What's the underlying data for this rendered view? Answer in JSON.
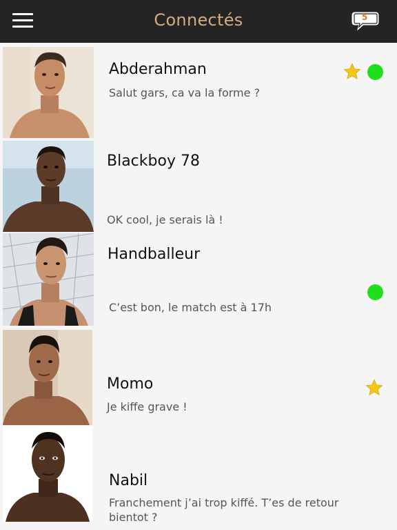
{
  "header": {
    "title": "Connectés",
    "menu_icon": "hamburger-menu-icon",
    "messages_icon": "chat-bubble-icon",
    "unread_count": "5",
    "unread_color": "#e0701a"
  },
  "colors": {
    "topbar": "#242424",
    "title": "#d8ac7c",
    "online": "#1ee01a",
    "star": "#f5c518"
  },
  "contacts": [
    {
      "name": "Abderahman",
      "last_message": "Salut gars, ca va la forme ?",
      "favorite": true,
      "online": true
    },
    {
      "name": "Blackboy 78",
      "last_message": "OK cool, je serais là !",
      "favorite": false,
      "online": false
    },
    {
      "name": "Handballeur",
      "last_message": "C’est bon, le match est à 17h",
      "favorite": false,
      "online": true
    },
    {
      "name": "Momo",
      "last_message": "Je kiffe grave !",
      "favorite": true,
      "online": false
    },
    {
      "name": "Nabil",
      "last_message": "Franchement j’ai trop kiffé. T’es de retour bientot ?",
      "favorite": false,
      "online": false
    }
  ]
}
